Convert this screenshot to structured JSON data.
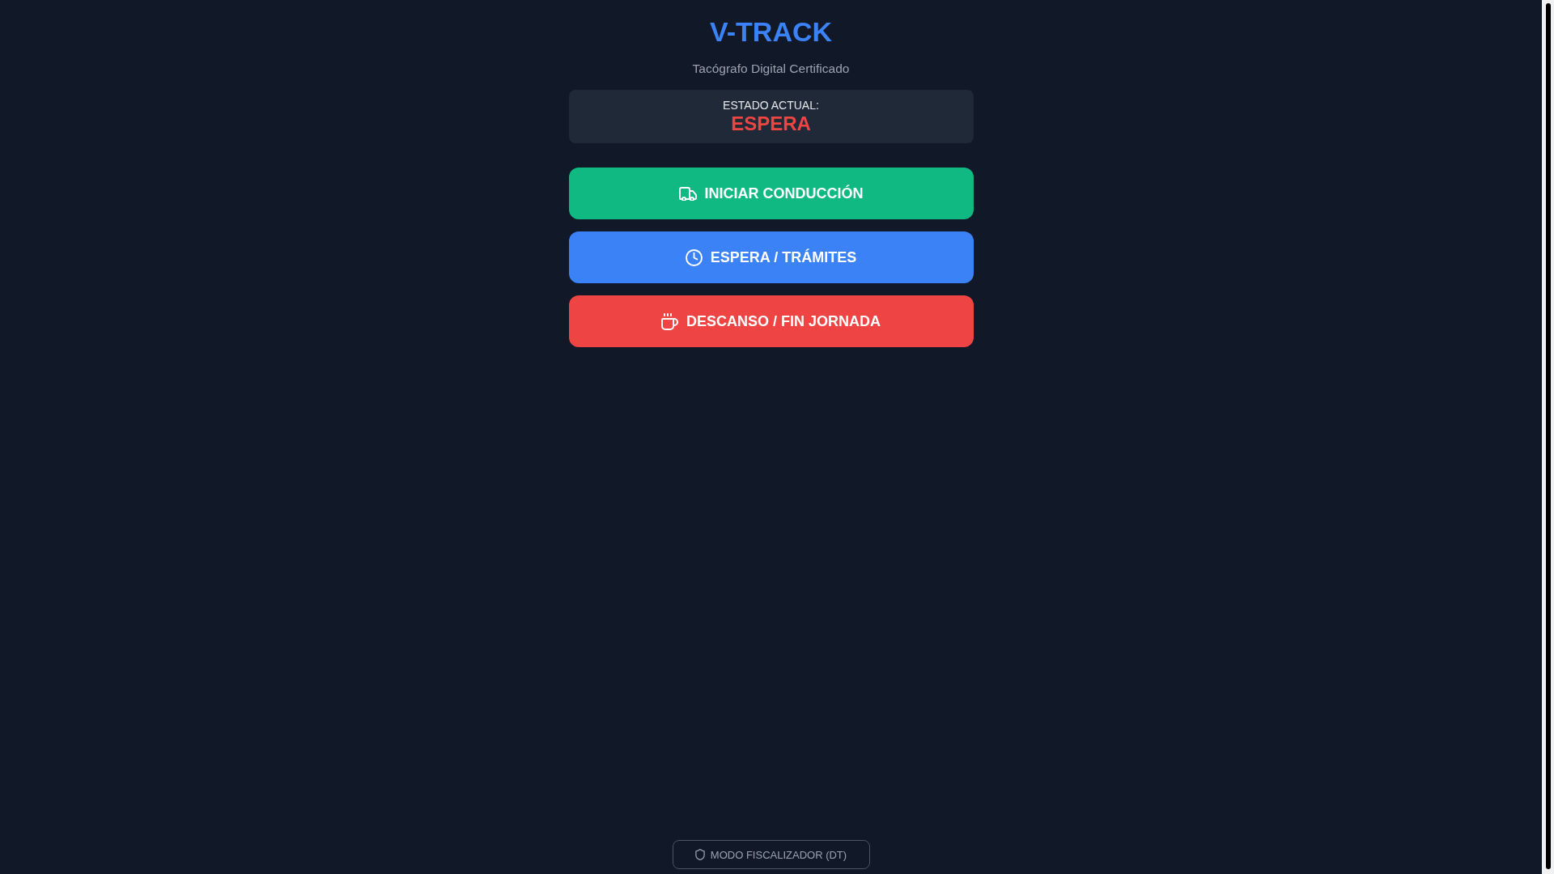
{
  "header": {
    "title": "V-TRACK",
    "subtitle": "Tacógrafo Digital Certificado"
  },
  "status": {
    "label": "ESTADO ACTUAL:",
    "value": "ESPERA"
  },
  "actions": [
    {
      "kind": "drive",
      "label": "INICIAR CONDUCCIÓN"
    },
    {
      "kind": "wait",
      "label": "ESPERA / TRÁMITES"
    },
    {
      "kind": "rest",
      "label": "DESCANSO / FIN JORNADA"
    }
  ],
  "inspector_button": {
    "label": "MODO FISCALIZADOR (DT)"
  }
}
